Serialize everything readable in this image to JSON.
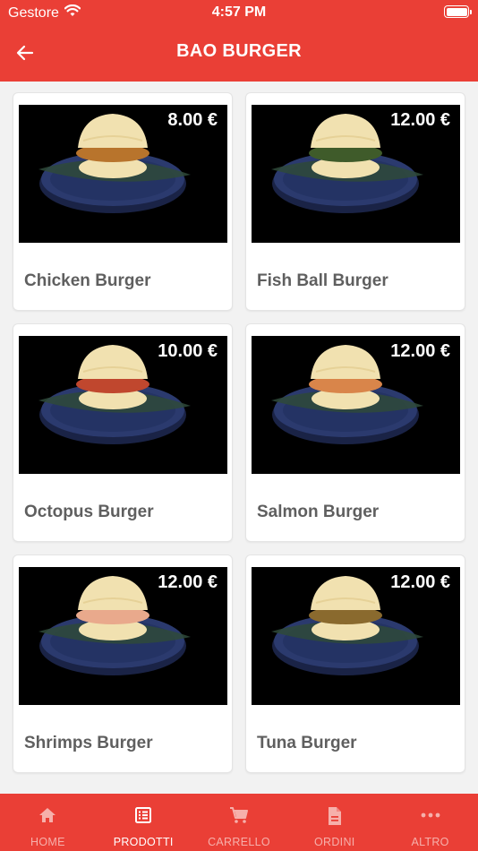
{
  "status_bar": {
    "carrier": "Gestore",
    "time": "4:57 PM"
  },
  "header": {
    "title": "BAO BURGER",
    "back_icon": "arrow-left-icon"
  },
  "colors": {
    "primary": "#ea3f36",
    "plate": "#2b3a6e",
    "leaf": "#2f4a3a",
    "bun": "#f1e1b0",
    "tab_inactive": "#f6b0ab"
  },
  "products": [
    {
      "name": "Chicken Burger",
      "price": "8.00 €"
    },
    {
      "name": "Fish Ball  Burger",
      "price": "12.00 €"
    },
    {
      "name": "Octopus Burger",
      "price": "10.00 €"
    },
    {
      "name": "Salmon Burger",
      "price": "12.00 €"
    },
    {
      "name": "Shrimps Burger",
      "price": "12.00 €"
    },
    {
      "name": "Tuna Burger",
      "price": "12.00 €"
    }
  ],
  "tabbar": {
    "active": "PRODOTTI",
    "items": [
      {
        "label": "HOME",
        "icon": "home-icon"
      },
      {
        "label": "PRODOTTI",
        "icon": "list-icon"
      },
      {
        "label": "CARRELLO",
        "icon": "cart-icon"
      },
      {
        "label": "ORDINI",
        "icon": "document-icon"
      },
      {
        "label": "ALTRO",
        "icon": "more-icon"
      }
    ]
  }
}
